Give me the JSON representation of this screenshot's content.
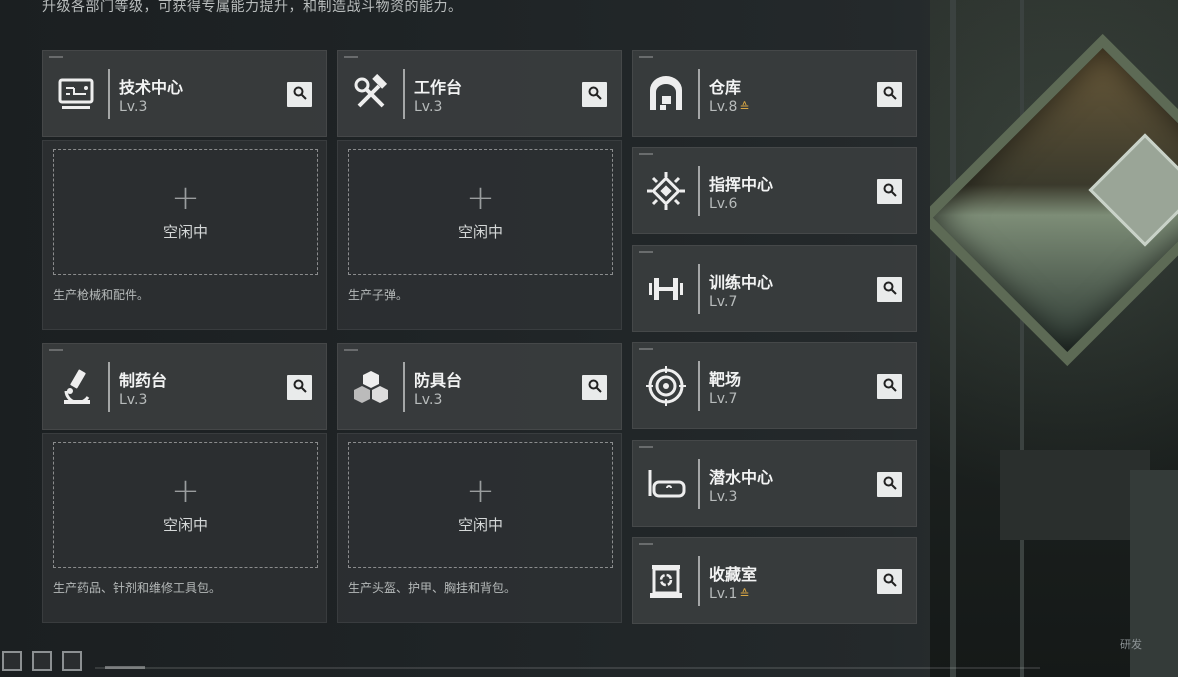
{
  "header": {
    "description": "升级各部门等级，可获得专属能力提升，和制造战斗物资的能力。"
  },
  "left_columns": [
    {
      "name": "技术中心",
      "level": "Lv.3",
      "icon": "computer-icon",
      "slot": {
        "plus": "+",
        "status": "空闲中",
        "description": "生产枪械和配件。"
      }
    },
    {
      "name": "工作台",
      "level": "Lv.3",
      "icon": "hammer-wrench-icon",
      "slot": {
        "plus": "+",
        "status": "空闲中",
        "description": "生产子弹。"
      }
    },
    {
      "name": "制药台",
      "level": "Lv.3",
      "icon": "microscope-icon",
      "slot": {
        "plus": "+",
        "status": "空闲中",
        "description": "生产药品、针剂和维修工具包。"
      }
    },
    {
      "name": "防具台",
      "level": "Lv.3",
      "icon": "cubes-icon",
      "slot": {
        "plus": "+",
        "status": "空闲中",
        "description": "生产头盔、护甲、胸挂和背包。"
      }
    }
  ],
  "right_list": [
    {
      "name": "仓库",
      "level": "Lv.8",
      "upgradable": true,
      "icon": "warehouse-icon"
    },
    {
      "name": "指挥中心",
      "level": "Lv.6",
      "upgradable": false,
      "icon": "chip-icon"
    },
    {
      "name": "训练中心",
      "level": "Lv.7",
      "upgradable": false,
      "icon": "dumbbell-icon"
    },
    {
      "name": "靶场",
      "level": "Lv.7",
      "upgradable": false,
      "icon": "target-icon"
    },
    {
      "name": "潜水中心",
      "level": "Lv.3",
      "upgradable": false,
      "icon": "diving-mask-icon"
    },
    {
      "name": "收藏室",
      "level": "Lv.1",
      "upgradable": true,
      "icon": "display-case-icon"
    }
  ],
  "upgrade_glyph": "≙",
  "watermark": "研发",
  "colors": {
    "upgrade": "#d8a643",
    "card": "#3a3d3e",
    "slot": "#2c2f31"
  }
}
